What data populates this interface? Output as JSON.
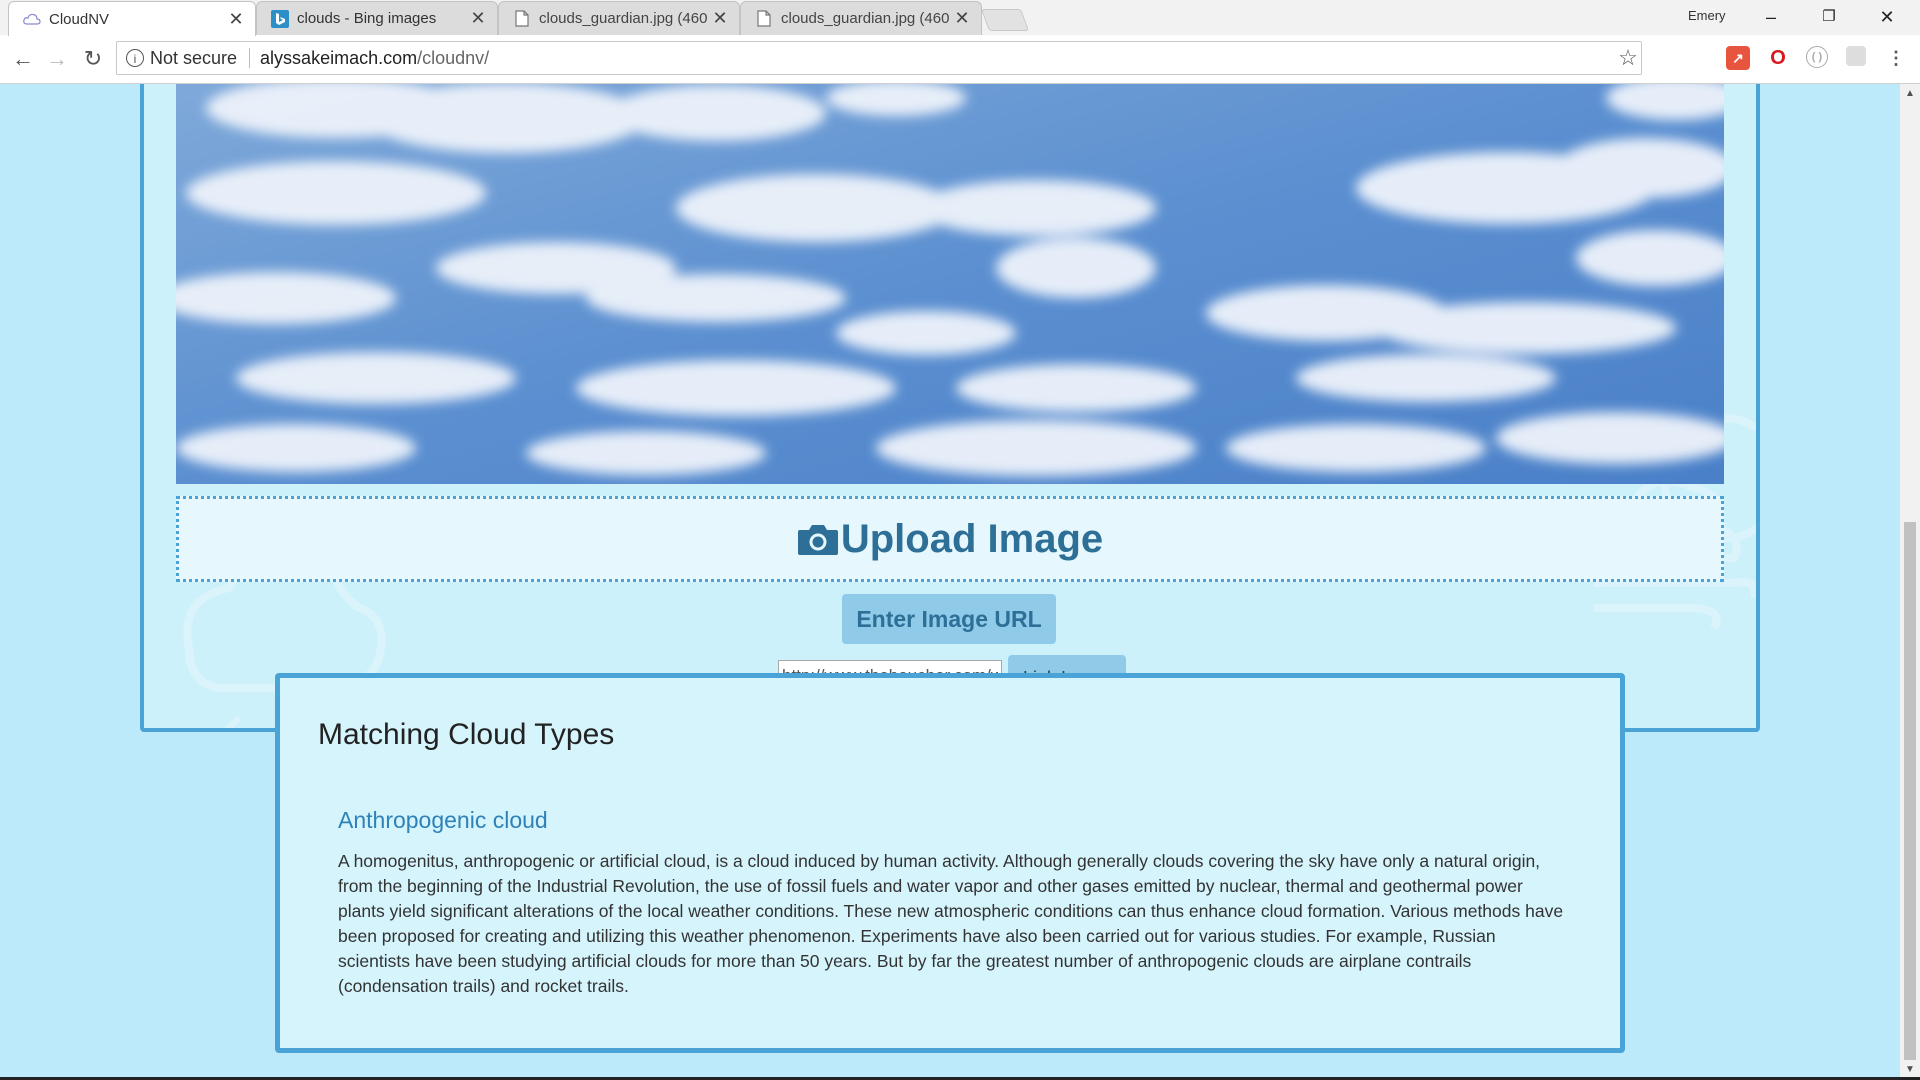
{
  "browser": {
    "tabs": [
      {
        "title": "CloudNV",
        "icon": "cloud-favicon",
        "active": true
      },
      {
        "title": "clouds - Bing images",
        "icon": "bing-favicon",
        "active": false
      },
      {
        "title": "clouds_guardian.jpg (460",
        "icon": "file-icon",
        "active": false
      },
      {
        "title": "clouds_guardian.jpg (460",
        "icon": "file-icon",
        "active": false
      }
    ],
    "close_glyph": "✕",
    "profile_name": "Emery",
    "address": {
      "security_label": "Not secure",
      "domain": "alyssakeimach.com",
      "path": "/cloudnv/"
    }
  },
  "page": {
    "upload": {
      "upload_label": "Upload Image",
      "enter_url_label": "Enter Image URL",
      "url_input_value": "http://www.theboucher.com/wp-content/",
      "link_button_label": "Link Image"
    },
    "results": {
      "heading": "Matching Cloud Types",
      "items": [
        {
          "name": "Anthropogenic cloud",
          "description": "A homogenitus, anthropogenic or artificial cloud, is a cloud induced by human activity. Although generally clouds covering the sky have only a natural origin, from the beginning of the Industrial Revolution, the use of fossil fuels and water vapor and other gases emitted by nuclear, thermal and geothermal power plants yield significant alterations of the local weather conditions. These new atmospheric conditions can thus enhance cloud formation. Various methods have been proposed for creating and utilizing this weather phenomenon. Experiments have also been carried out for various studies. For example, Russian scientists have been studying artificial clouds for more than 50 years. But by far the greatest number of anthropogenic clouds are airplane contrails (condensation trails) and rocket trails."
        }
      ]
    }
  },
  "colors": {
    "page_bg": "#bdeafb",
    "card_border": "#4aa3d6",
    "button_bg": "#8fcbe9",
    "heading_blue": "#2d6f96",
    "link_blue": "#2f82b8"
  }
}
